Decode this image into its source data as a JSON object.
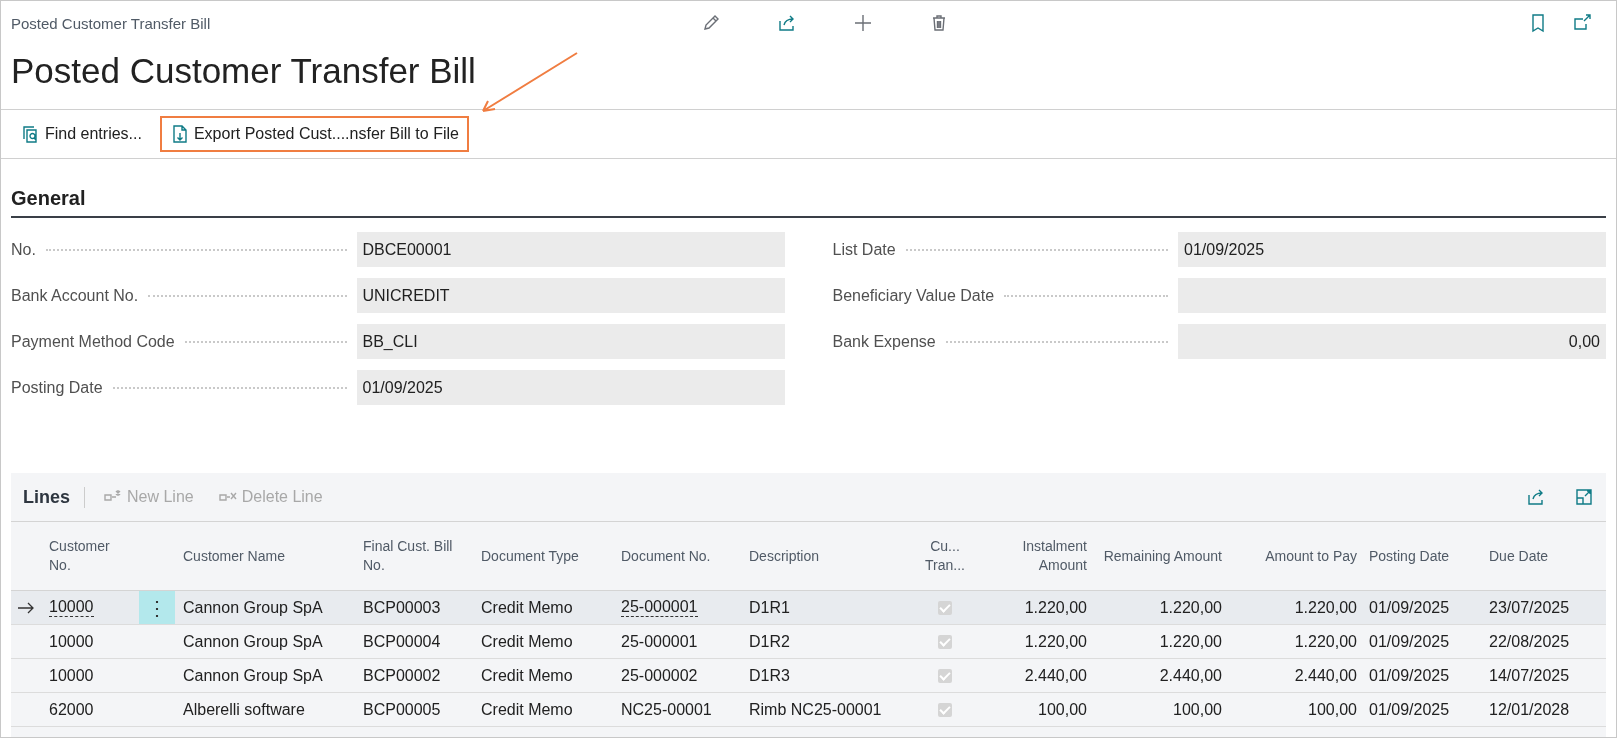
{
  "window": {
    "title": "Posted Customer Transfer Bill"
  },
  "page_title": "Posted Customer Transfer Bill",
  "actions": [
    {
      "label": "Find entries...",
      "kind": "find",
      "highlighted": false
    },
    {
      "label": "Export Posted Cust....nsfer Bill to File",
      "kind": "export",
      "highlighted": true
    }
  ],
  "general": {
    "heading": "General",
    "fields_left": [
      {
        "label": "No.",
        "value": "DBCE00001"
      },
      {
        "label": "Bank Account No.",
        "value": "UNICREDIT"
      },
      {
        "label": "Payment Method Code",
        "value": "BB_CLI"
      },
      {
        "label": "Posting Date",
        "value": "01/09/2025"
      }
    ],
    "fields_right": [
      {
        "label": "List Date",
        "value": "01/09/2025"
      },
      {
        "label": "Beneficiary Value Date"
      },
      {
        "label": "Bank Expense",
        "value": "0,00",
        "kind": "amount"
      }
    ]
  },
  "lines": {
    "title": "Lines",
    "row_menu_glyph": "⋮",
    "actions": [
      {
        "label": "New Line",
        "kind": "new",
        "disabled": true
      },
      {
        "label": "Delete Line",
        "kind": "delete",
        "disabled": true
      }
    ],
    "columns": [
      "Customer No.",
      "Customer Name",
      "Final Cust. Bill No.",
      "Document Type",
      "Document No.",
      "Description",
      "Cu... Tran...",
      "Instalment Amount",
      "Remaining Amount",
      "Amount to Pay",
      "Posting Date",
      "Due Date"
    ],
    "rows": [
      {
        "selected": true,
        "customer_no": "10000",
        "customer_name": "Cannon Group SpA",
        "final_bill_no": "BCP00003",
        "document_type": "Credit Memo",
        "document_no": "25-000001",
        "description": "D1R1",
        "transferred": true,
        "instalment_amount": "1.220,00",
        "remaining_amount": "1.220,00",
        "amount_to_pay": "1.220,00",
        "posting_date": "01/09/2025",
        "due_date": "23/07/2025"
      },
      {
        "selected": false,
        "customer_no": "10000",
        "customer_name": "Cannon Group SpA",
        "final_bill_no": "BCP00004",
        "document_type": "Credit Memo",
        "document_no": "25-000001",
        "description": "D1R2",
        "transferred": true,
        "instalment_amount": "1.220,00",
        "remaining_amount": "1.220,00",
        "amount_to_pay": "1.220,00",
        "posting_date": "01/09/2025",
        "due_date": "22/08/2025"
      },
      {
        "selected": false,
        "customer_no": "10000",
        "customer_name": "Cannon Group SpA",
        "final_bill_no": "BCP00002",
        "document_type": "Credit Memo",
        "document_no": "25-000002",
        "description": "D1R3",
        "transferred": true,
        "instalment_amount": "2.440,00",
        "remaining_amount": "2.440,00",
        "amount_to_pay": "2.440,00",
        "posting_date": "01/09/2025",
        "due_date": "14/07/2025"
      },
      {
        "selected": false,
        "customer_no": "62000",
        "customer_name": "Alberelli software",
        "final_bill_no": "BCP00005",
        "document_type": "Credit Memo",
        "document_no": "NC25-00001",
        "description": "Rimb NC25-00001",
        "transferred": true,
        "instalment_amount": "100,00",
        "remaining_amount": "100,00",
        "amount_to_pay": "100,00",
        "posting_date": "01/09/2025",
        "due_date": "12/01/2028"
      }
    ]
  }
}
